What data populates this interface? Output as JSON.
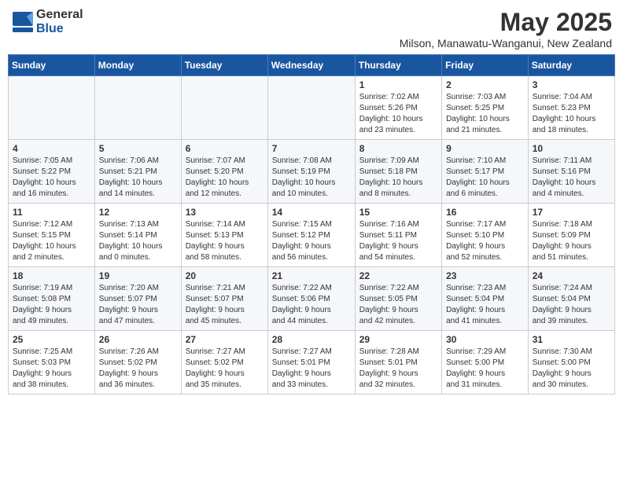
{
  "logo": {
    "general": "General",
    "blue": "Blue"
  },
  "title": "May 2025",
  "location": "Milson, Manawatu-Wanganui, New Zealand",
  "days_of_week": [
    "Sunday",
    "Monday",
    "Tuesday",
    "Wednesday",
    "Thursday",
    "Friday",
    "Saturday"
  ],
  "weeks": [
    [
      {
        "day": "",
        "info": ""
      },
      {
        "day": "",
        "info": ""
      },
      {
        "day": "",
        "info": ""
      },
      {
        "day": "",
        "info": ""
      },
      {
        "day": "1",
        "info": "Sunrise: 7:02 AM\nSunset: 5:26 PM\nDaylight: 10 hours\nand 23 minutes."
      },
      {
        "day": "2",
        "info": "Sunrise: 7:03 AM\nSunset: 5:25 PM\nDaylight: 10 hours\nand 21 minutes."
      },
      {
        "day": "3",
        "info": "Sunrise: 7:04 AM\nSunset: 5:23 PM\nDaylight: 10 hours\nand 18 minutes."
      }
    ],
    [
      {
        "day": "4",
        "info": "Sunrise: 7:05 AM\nSunset: 5:22 PM\nDaylight: 10 hours\nand 16 minutes."
      },
      {
        "day": "5",
        "info": "Sunrise: 7:06 AM\nSunset: 5:21 PM\nDaylight: 10 hours\nand 14 minutes."
      },
      {
        "day": "6",
        "info": "Sunrise: 7:07 AM\nSunset: 5:20 PM\nDaylight: 10 hours\nand 12 minutes."
      },
      {
        "day": "7",
        "info": "Sunrise: 7:08 AM\nSunset: 5:19 PM\nDaylight: 10 hours\nand 10 minutes."
      },
      {
        "day": "8",
        "info": "Sunrise: 7:09 AM\nSunset: 5:18 PM\nDaylight: 10 hours\nand 8 minutes."
      },
      {
        "day": "9",
        "info": "Sunrise: 7:10 AM\nSunset: 5:17 PM\nDaylight: 10 hours\nand 6 minutes."
      },
      {
        "day": "10",
        "info": "Sunrise: 7:11 AM\nSunset: 5:16 PM\nDaylight: 10 hours\nand 4 minutes."
      }
    ],
    [
      {
        "day": "11",
        "info": "Sunrise: 7:12 AM\nSunset: 5:15 PM\nDaylight: 10 hours\nand 2 minutes."
      },
      {
        "day": "12",
        "info": "Sunrise: 7:13 AM\nSunset: 5:14 PM\nDaylight: 10 hours\nand 0 minutes."
      },
      {
        "day": "13",
        "info": "Sunrise: 7:14 AM\nSunset: 5:13 PM\nDaylight: 9 hours\nand 58 minutes."
      },
      {
        "day": "14",
        "info": "Sunrise: 7:15 AM\nSunset: 5:12 PM\nDaylight: 9 hours\nand 56 minutes."
      },
      {
        "day": "15",
        "info": "Sunrise: 7:16 AM\nSunset: 5:11 PM\nDaylight: 9 hours\nand 54 minutes."
      },
      {
        "day": "16",
        "info": "Sunrise: 7:17 AM\nSunset: 5:10 PM\nDaylight: 9 hours\nand 52 minutes."
      },
      {
        "day": "17",
        "info": "Sunrise: 7:18 AM\nSunset: 5:09 PM\nDaylight: 9 hours\nand 51 minutes."
      }
    ],
    [
      {
        "day": "18",
        "info": "Sunrise: 7:19 AM\nSunset: 5:08 PM\nDaylight: 9 hours\nand 49 minutes."
      },
      {
        "day": "19",
        "info": "Sunrise: 7:20 AM\nSunset: 5:07 PM\nDaylight: 9 hours\nand 47 minutes."
      },
      {
        "day": "20",
        "info": "Sunrise: 7:21 AM\nSunset: 5:07 PM\nDaylight: 9 hours\nand 45 minutes."
      },
      {
        "day": "21",
        "info": "Sunrise: 7:22 AM\nSunset: 5:06 PM\nDaylight: 9 hours\nand 44 minutes."
      },
      {
        "day": "22",
        "info": "Sunrise: 7:22 AM\nSunset: 5:05 PM\nDaylight: 9 hours\nand 42 minutes."
      },
      {
        "day": "23",
        "info": "Sunrise: 7:23 AM\nSunset: 5:04 PM\nDaylight: 9 hours\nand 41 minutes."
      },
      {
        "day": "24",
        "info": "Sunrise: 7:24 AM\nSunset: 5:04 PM\nDaylight: 9 hours\nand 39 minutes."
      }
    ],
    [
      {
        "day": "25",
        "info": "Sunrise: 7:25 AM\nSunset: 5:03 PM\nDaylight: 9 hours\nand 38 minutes."
      },
      {
        "day": "26",
        "info": "Sunrise: 7:26 AM\nSunset: 5:02 PM\nDaylight: 9 hours\nand 36 minutes."
      },
      {
        "day": "27",
        "info": "Sunrise: 7:27 AM\nSunset: 5:02 PM\nDaylight: 9 hours\nand 35 minutes."
      },
      {
        "day": "28",
        "info": "Sunrise: 7:27 AM\nSunset: 5:01 PM\nDaylight: 9 hours\nand 33 minutes."
      },
      {
        "day": "29",
        "info": "Sunrise: 7:28 AM\nSunset: 5:01 PM\nDaylight: 9 hours\nand 32 minutes."
      },
      {
        "day": "30",
        "info": "Sunrise: 7:29 AM\nSunset: 5:00 PM\nDaylight: 9 hours\nand 31 minutes."
      },
      {
        "day": "31",
        "info": "Sunrise: 7:30 AM\nSunset: 5:00 PM\nDaylight: 9 hours\nand 30 minutes."
      }
    ]
  ]
}
